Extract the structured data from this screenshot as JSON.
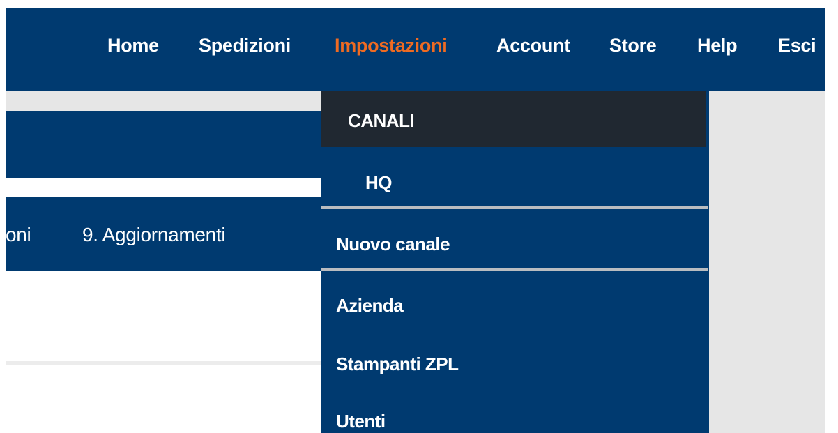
{
  "nav": {
    "items": [
      {
        "label": "Home"
      },
      {
        "label": "Spedizioni"
      },
      {
        "label": "Impostazioni"
      },
      {
        "label": "Account"
      },
      {
        "label": "Store"
      },
      {
        "label": "Help"
      },
      {
        "label": "Esci"
      }
    ],
    "active": "Impostazioni",
    "accent_color": "#ef6b22",
    "bar_color": "#003a70"
  },
  "band": {
    "partial_tab": "oni",
    "tab_9": "9. Aggiornamenti"
  },
  "dropdown": {
    "header": "CANALI",
    "channel": "HQ",
    "new_channel": "Nuovo canale",
    "items": [
      {
        "label": "Azienda"
      },
      {
        "label": "Stampanti ZPL"
      },
      {
        "label": "Utenti"
      }
    ],
    "header_color": "#202831"
  }
}
